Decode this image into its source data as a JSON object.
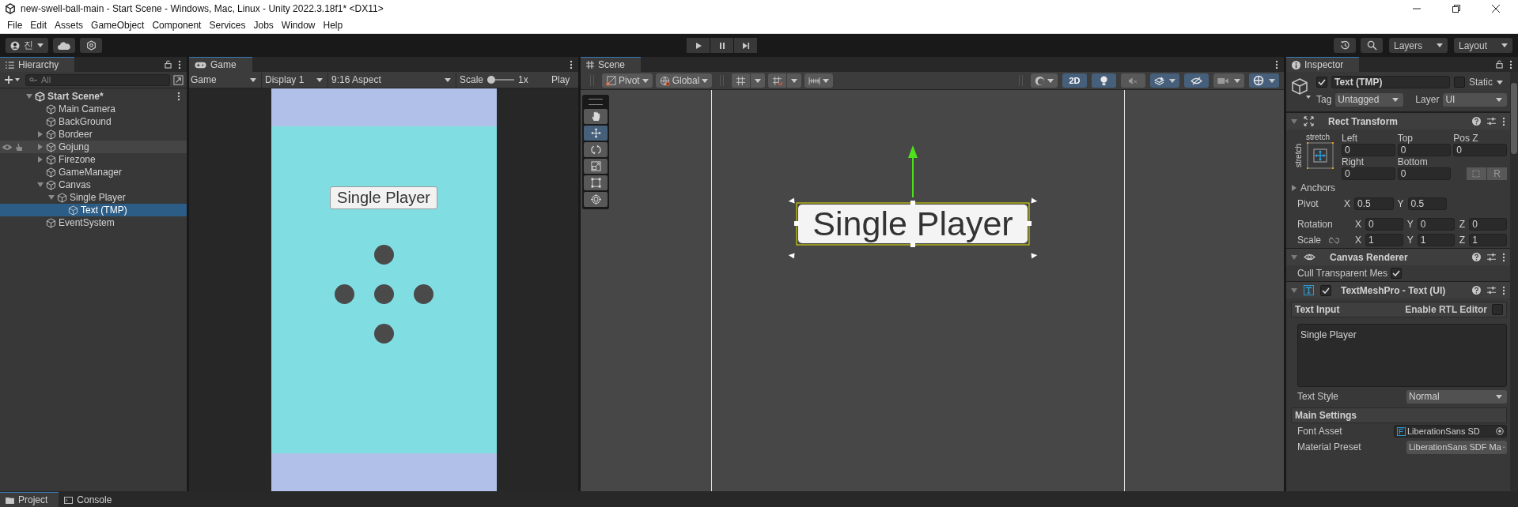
{
  "window": {
    "title": "new-swell-ball-main - Start Scene - Windows, Mac, Linux - Unity 2022.3.18f1* <DX11>"
  },
  "menu": [
    "File",
    "Edit",
    "Assets",
    "GameObject",
    "Component",
    "Services",
    "Jobs",
    "Window",
    "Help"
  ],
  "main_toolbar": {
    "account": "진",
    "layers": "Layers",
    "layout": "Layout"
  },
  "hierarchy": {
    "title": "Hierarchy",
    "search": {
      "placeholder": "All"
    },
    "scene": {
      "label": "Start Scene*",
      "expanded": true,
      "children": [
        {
          "label": "Main Camera",
          "selected": false,
          "hovered": false
        },
        {
          "label": "BackGround",
          "selected": false,
          "hovered": false
        },
        {
          "label": "Bordeer",
          "expanded": false,
          "selected": false,
          "hovered": false
        },
        {
          "label": "Gojung",
          "expanded": false,
          "selected": false,
          "hovered": true
        },
        {
          "label": "Firezone",
          "expanded": false,
          "selected": false,
          "hovered": false
        },
        {
          "label": "GameManager",
          "selected": false,
          "hovered": false
        },
        {
          "label": "Canvas",
          "expanded": true,
          "selected": false,
          "hovered": false,
          "children": [
            {
              "label": "Single Player",
              "expanded": true,
              "selected": false,
              "hovered": false,
              "children": [
                {
                  "label": "Text (TMP)",
                  "selected": true,
                  "hovered": false
                }
              ]
            }
          ]
        },
        {
          "label": "EventSystem",
          "selected": false,
          "hovered": false
        }
      ]
    }
  },
  "game": {
    "title": "Game",
    "mode": "Game",
    "display": "Display 1",
    "aspect": "9:16 Aspect",
    "scale_label": "Scale",
    "scale": {
      "level": 0
    },
    "scale_value": "1x",
    "play": "Play",
    "button": "Single Player"
  },
  "scene": {
    "title": "Scene",
    "pivot": "Pivot",
    "space": "Global",
    "tools": [
      {
        "kind": "hand",
        "selected": false
      },
      {
        "kind": "move",
        "selected": true
      },
      {
        "kind": "rotate",
        "selected": false
      },
      {
        "kind": "scale",
        "selected": false
      },
      {
        "kind": "rect",
        "selected": false
      },
      {
        "kind": "transform",
        "selected": false
      }
    ],
    "toggles": [
      {
        "kind": "mode2d",
        "label": "2D",
        "on": true
      },
      {
        "kind": "lighting",
        "on": true
      },
      {
        "kind": "audio",
        "on": false
      },
      {
        "kind": "effects",
        "on": true
      },
      {
        "kind": "visibility",
        "on": true
      },
      {
        "kind": "camera",
        "on": false
      },
      {
        "kind": "gizmos",
        "on": true
      }
    ],
    "object_text": "Single Player"
  },
  "inspector": {
    "title": "Inspector",
    "object": {
      "active": true,
      "name": "Text (TMP)",
      "static_label": "Static",
      "static": false,
      "tag_label": "Tag",
      "tag": "Untagged",
      "layer_label": "Layer",
      "layer": "UI"
    },
    "rect_transform": {
      "title": "Rect Transform",
      "expanded": true,
      "preset_top": "stretch",
      "preset_side": "stretch",
      "fields_top": [
        {
          "label": "Left",
          "value": "0"
        },
        {
          "label": "Top",
          "value": "0"
        },
        {
          "label": "Pos Z",
          "value": "0"
        }
      ],
      "fields_bottom": [
        {
          "label": "Right",
          "value": "0"
        },
        {
          "label": "Bottom",
          "value": "0"
        }
      ],
      "raw_button": "R",
      "anchors": "Anchors",
      "pivot": {
        "label": "Pivot",
        "values": [
          {
            "axis": "X",
            "value": "0.5"
          },
          {
            "axis": "Y",
            "value": "0.5"
          }
        ]
      },
      "rotation": {
        "label": "Rotation",
        "values": [
          {
            "axis": "X",
            "value": "0"
          },
          {
            "axis": "Y",
            "value": "0"
          },
          {
            "axis": "Z",
            "value": "0"
          }
        ]
      },
      "scale": {
        "label": "Scale",
        "values": [
          {
            "axis": "X",
            "value": "1"
          },
          {
            "axis": "Y",
            "value": "1"
          },
          {
            "axis": "Z",
            "value": "1"
          }
        ]
      }
    },
    "canvas_renderer": {
      "title": "Canvas Renderer",
      "expanded": true,
      "cull_label": "Cull Transparent Mes",
      "cull": true
    },
    "tmp": {
      "title": "TextMeshPro - Text (UI)",
      "enabled": true,
      "expanded": true,
      "text_input": "Text Input",
      "rtl_label": "Enable RTL Editor",
      "rtl": false,
      "text": "Single Player",
      "text_style_label": "Text Style",
      "text_style": "Normal",
      "main_settings": "Main Settings",
      "font_asset_label": "Font Asset",
      "font_asset": "LiberationSans SD",
      "material_label": "Material Preset",
      "material": "LiberationSans SDF Ma"
    }
  },
  "bottom_tabs": [
    {
      "label": "Project",
      "selected": true
    },
    {
      "label": "Console",
      "selected": false
    }
  ]
}
